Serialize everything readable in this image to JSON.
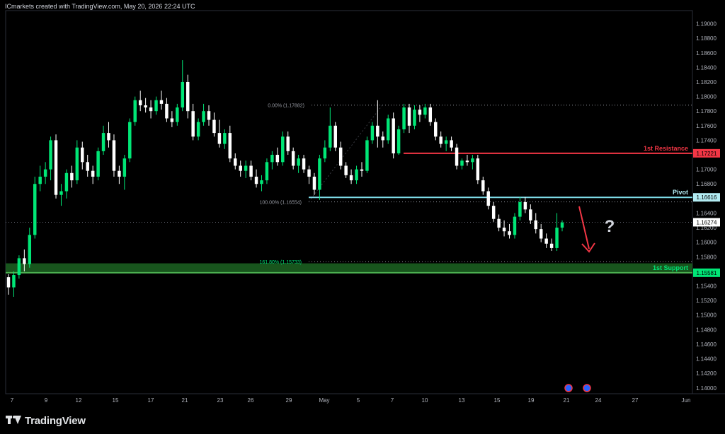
{
  "header": {
    "attribution": "ICmarkets created with TradingView.com, May 20, 2026 22:24 UTC"
  },
  "brand": {
    "name": "TradingView",
    "icon": "tradingview-logo-icon"
  },
  "chart_data": {
    "type": "candlestick",
    "instrument_price_current": 1.16274,
    "ylim": [
      1.1392,
      1.1918
    ],
    "y_ticks": [
      "1.19000",
      "1.18800",
      "1.18600",
      "1.18400",
      "1.18200",
      "1.18000",
      "1.17800",
      "1.17600",
      "1.17400",
      "1.17200",
      "1.17000",
      "1.16800",
      "1.16600",
      "1.16400",
      "1.16200",
      "1.16000",
      "1.15800",
      "1.15600",
      "1.15400",
      "1.15200",
      "1.15000",
      "1.14800",
      "1.14600",
      "1.14400",
      "1.14200",
      "1.14000"
    ],
    "x_ticks": [
      "7",
      "9",
      "12",
      "15",
      "17",
      "21",
      "23",
      "26",
      "29",
      "May",
      "5",
      "7",
      "10",
      "13",
      "15",
      "19",
      "21",
      "24",
      "27",
      "Jun"
    ],
    "grid": false,
    "levels": [
      {
        "name": "1st Resistance",
        "value": "1.17221",
        "color": "#f23645",
        "badge_color": "#f23645"
      },
      {
        "name": "Pivot",
        "value": "1.16616",
        "color": "#80deea",
        "badge_color": "#b2ebf2"
      },
      {
        "name": "1st Support",
        "value": "1.15581",
        "color": "#4caf50",
        "badge_color": "#00e676"
      }
    ],
    "current_price_label": "1.16274",
    "fibonacci": [
      {
        "label": "0.00% (1.17882)",
        "value": 1.17882
      },
      {
        "label": "100.00% (1.16554)",
        "value": 1.16554
      },
      {
        "label": "161.80% (1.15733)",
        "value": 1.15733
      }
    ],
    "support_zone": [
      1.1558,
      1.1571
    ],
    "annotation": {
      "question_mark": "?",
      "arrow": "down",
      "arrow_color": "#f23645"
    },
    "up_color": "#00e676",
    "down_color": "#ffffff",
    "candles": [
      [
        1.1552,
        1.1556,
        1.1528,
        1.1538
      ],
      [
        1.1538,
        1.156,
        1.1525,
        1.1555
      ],
      [
        1.1555,
        1.1582,
        1.155,
        1.1578
      ],
      [
        1.1578,
        1.159,
        1.156,
        1.157
      ],
      [
        1.157,
        1.162,
        1.1565,
        1.161
      ],
      [
        1.161,
        1.169,
        1.1605,
        1.168
      ],
      [
        1.168,
        1.1705,
        1.167,
        1.169
      ],
      [
        1.169,
        1.171,
        1.168,
        1.17
      ],
      [
        1.17,
        1.1745,
        1.1685,
        1.174
      ],
      [
        1.174,
        1.1748,
        1.166,
        1.1665
      ],
      [
        1.1665,
        1.168,
        1.165,
        1.167
      ],
      [
        1.167,
        1.17,
        1.166,
        1.1695
      ],
      [
        1.1695,
        1.1705,
        1.1675,
        1.1685
      ],
      [
        1.1685,
        1.174,
        1.168,
        1.173
      ],
      [
        1.173,
        1.1738,
        1.17,
        1.171
      ],
      [
        1.171,
        1.172,
        1.169,
        1.1698
      ],
      [
        1.1698,
        1.1705,
        1.168,
        1.169
      ],
      [
        1.169,
        1.173,
        1.1685,
        1.1725
      ],
      [
        1.1725,
        1.176,
        1.172,
        1.175
      ],
      [
        1.175,
        1.1765,
        1.173,
        1.174
      ],
      [
        1.174,
        1.1748,
        1.169,
        1.1698
      ],
      [
        1.1698,
        1.1705,
        1.168,
        1.169
      ],
      [
        1.169,
        1.172,
        1.1672,
        1.1715
      ],
      [
        1.1715,
        1.177,
        1.171,
        1.1765
      ],
      [
        1.1765,
        1.18,
        1.176,
        1.1795
      ],
      [
        1.1795,
        1.1808,
        1.178,
        1.1788
      ],
      [
        1.1788,
        1.1798,
        1.1778,
        1.1785
      ],
      [
        1.1785,
        1.1795,
        1.177,
        1.178
      ],
      [
        1.178,
        1.18,
        1.1775,
        1.1795
      ],
      [
        1.1795,
        1.1808,
        1.1782,
        1.179
      ],
      [
        1.179,
        1.1798,
        1.1765,
        1.177
      ],
      [
        1.177,
        1.178,
        1.1758,
        1.1765
      ],
      [
        1.1765,
        1.179,
        1.176,
        1.1785
      ],
      [
        1.1785,
        1.185,
        1.178,
        1.182
      ],
      [
        1.182,
        1.183,
        1.177,
        1.178
      ],
      [
        1.178,
        1.179,
        1.174,
        1.1745
      ],
      [
        1.1745,
        1.177,
        1.174,
        1.1765
      ],
      [
        1.1765,
        1.179,
        1.176,
        1.178
      ],
      [
        1.178,
        1.1788,
        1.176,
        1.1768
      ],
      [
        1.1768,
        1.1778,
        1.1745,
        1.175
      ],
      [
        1.175,
        1.1768,
        1.173,
        1.1735
      ],
      [
        1.1735,
        1.1755,
        1.1728,
        1.175
      ],
      [
        1.175,
        1.176,
        1.171,
        1.1715
      ],
      [
        1.1715,
        1.1722,
        1.17,
        1.1705
      ],
      [
        1.1705,
        1.1712,
        1.169,
        1.1698
      ],
      [
        1.1698,
        1.1712,
        1.1688,
        1.1705
      ],
      [
        1.1705,
        1.1712,
        1.1685,
        1.169
      ],
      [
        1.169,
        1.17,
        1.1675,
        1.168
      ],
      [
        1.168,
        1.1692,
        1.167,
        1.1685
      ],
      [
        1.1685,
        1.1715,
        1.168,
        1.171
      ],
      [
        1.171,
        1.1725,
        1.17,
        1.172
      ],
      [
        1.172,
        1.173,
        1.1705,
        1.171
      ],
      [
        1.171,
        1.1752,
        1.1705,
        1.1745
      ],
      [
        1.1745,
        1.1752,
        1.172,
        1.1725
      ],
      [
        1.1725,
        1.173,
        1.17,
        1.1705
      ],
      [
        1.1705,
        1.172,
        1.1695,
        1.1715
      ],
      [
        1.1715,
        1.172,
        1.1695,
        1.17
      ],
      [
        1.17,
        1.1705,
        1.168,
        1.169
      ],
      [
        1.169,
        1.1695,
        1.1665,
        1.1672
      ],
      [
        1.1672,
        1.172,
        1.1658,
        1.1715
      ],
      [
        1.1715,
        1.174,
        1.171,
        1.173
      ],
      [
        1.173,
        1.1785,
        1.1725,
        1.176
      ],
      [
        1.176,
        1.1765,
        1.1725,
        1.173
      ],
      [
        1.173,
        1.1738,
        1.17,
        1.1705
      ],
      [
        1.1705,
        1.171,
        1.1688,
        1.1692
      ],
      [
        1.1692,
        1.17,
        1.168,
        1.1685
      ],
      [
        1.1685,
        1.1705,
        1.168,
        1.17
      ],
      [
        1.17,
        1.171,
        1.169,
        1.1698
      ],
      [
        1.1698,
        1.1745,
        1.1695,
        1.174
      ],
      [
        1.174,
        1.1765,
        1.1735,
        1.176
      ],
      [
        1.176,
        1.1795,
        1.173,
        1.1745
      ],
      [
        1.1745,
        1.1752,
        1.173,
        1.174
      ],
      [
        1.174,
        1.1775,
        1.1735,
        1.177
      ],
      [
        1.177,
        1.1778,
        1.1715,
        1.1722
      ],
      [
        1.1722,
        1.176,
        1.172,
        1.1755
      ],
      [
        1.1755,
        1.179,
        1.175,
        1.1785
      ],
      [
        1.1785,
        1.179,
        1.175,
        1.176
      ],
      [
        1.176,
        1.1788,
        1.1755,
        1.1782
      ],
      [
        1.1782,
        1.1788,
        1.1765,
        1.1775
      ],
      [
        1.1775,
        1.179,
        1.177,
        1.1785
      ],
      [
        1.1785,
        1.179,
        1.176,
        1.1765
      ],
      [
        1.1765,
        1.177,
        1.174,
        1.1745
      ],
      [
        1.1745,
        1.1752,
        1.173,
        1.1735
      ],
      [
        1.1735,
        1.1745,
        1.1725,
        1.174
      ],
      [
        1.174,
        1.1745,
        1.1725,
        1.173
      ],
      [
        1.173,
        1.1735,
        1.17,
        1.1705
      ],
      [
        1.1705,
        1.1715,
        1.17,
        1.1712
      ],
      [
        1.1712,
        1.172,
        1.1705,
        1.171
      ],
      [
        1.171,
        1.172,
        1.17,
        1.1715
      ],
      [
        1.1715,
        1.172,
        1.168,
        1.1685
      ],
      [
        1.1685,
        1.169,
        1.1665,
        1.167
      ],
      [
        1.167,
        1.1675,
        1.1645,
        1.165
      ],
      [
        1.165,
        1.1655,
        1.1628,
        1.1632
      ],
      [
        1.1632,
        1.1638,
        1.1615,
        1.162
      ],
      [
        1.162,
        1.163,
        1.1608,
        1.1615
      ],
      [
        1.1615,
        1.1625,
        1.1605,
        1.161
      ],
      [
        1.161,
        1.164,
        1.1605,
        1.1635
      ],
      [
        1.1635,
        1.1662,
        1.163,
        1.1655
      ],
      [
        1.1655,
        1.1662,
        1.164,
        1.1645
      ],
      [
        1.1645,
        1.1652,
        1.1625,
        1.163
      ],
      [
        1.163,
        1.164,
        1.1612,
        1.1618
      ],
      [
        1.1618,
        1.1625,
        1.16,
        1.1605
      ],
      [
        1.1605,
        1.1612,
        1.1592,
        1.1598
      ],
      [
        1.1598,
        1.1605,
        1.1588,
        1.1592
      ],
      [
        1.1592,
        1.164,
        1.1588,
        1.162
      ],
      [
        1.162,
        1.163,
        1.1615,
        1.1627
      ]
    ]
  }
}
